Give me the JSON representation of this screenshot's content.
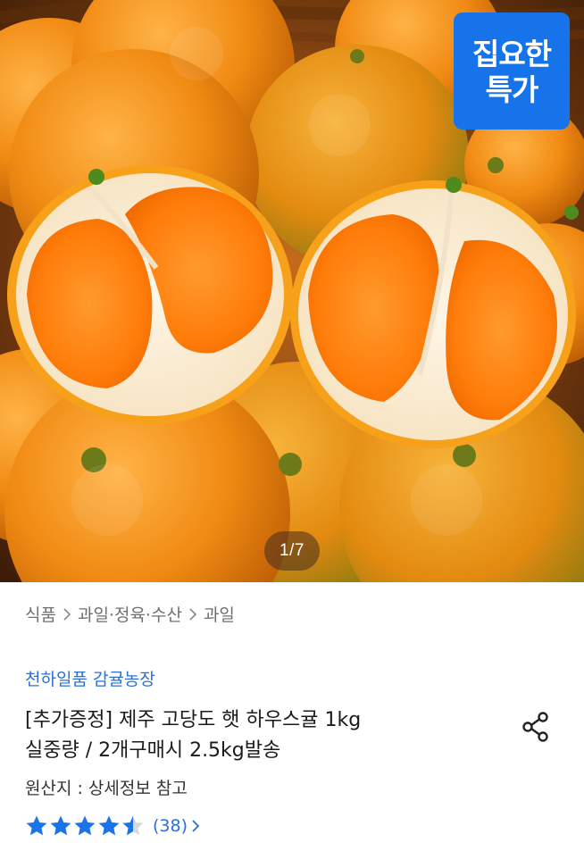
{
  "hero": {
    "deal_badge": {
      "line1": "집요한",
      "line2": "특가",
      "color": "#1673ea"
    },
    "image_counter": "1/7"
  },
  "breadcrumb": {
    "items": [
      "식품",
      "과일·정육·수산",
      "과일"
    ],
    "separator_icon": "chevron-right-icon"
  },
  "product": {
    "seller": "천하일품 감귤농장",
    "title_line1": "[추가증정] 제주 고당도 햇 하우스귤 1kg",
    "title_line2": "실중량 / 2개구매시 2.5kg발송",
    "origin": "원산지 : 상세정보 참고",
    "share_icon": "share-icon"
  },
  "rating": {
    "value": 4.5,
    "max": 5,
    "review_count": "(38)",
    "star_color": "#1a73e8"
  }
}
